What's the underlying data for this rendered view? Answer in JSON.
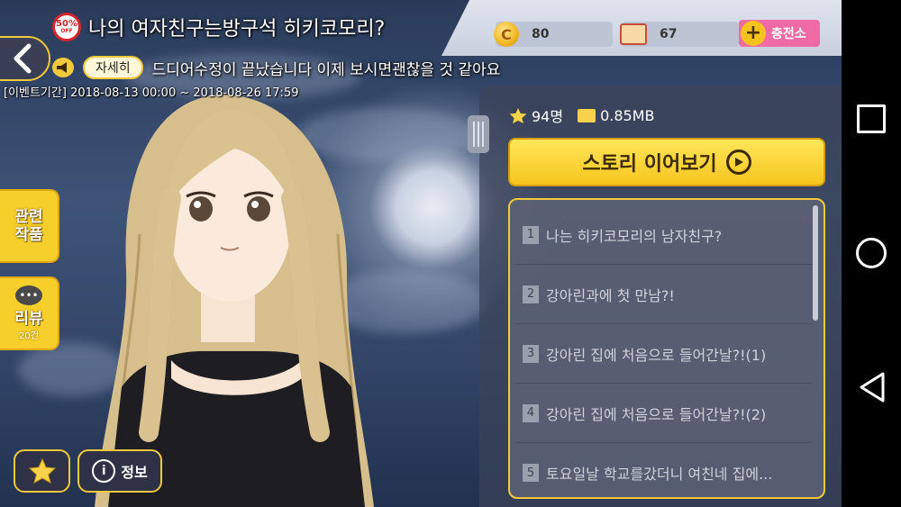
{
  "header": {
    "sale_badge": {
      "percent": "50%",
      "off": "OFF"
    },
    "title": "나의 여자친구는방구석 히키코모리?",
    "detail_button": "자세히",
    "notice": "드디어수정이 끝났습니다 이제 보시면괜찮을 것 같아요",
    "event_period": "[이벤트기간] 2018-08-13 00:00 ~ 2018-08-26 17:59"
  },
  "currency": {
    "coin_icon": "C",
    "coins": "80",
    "mail": "67",
    "charge_label": "충전소"
  },
  "side": {
    "related_label": "관련\n작품",
    "review_label": "리뷰",
    "review_count": "20건",
    "info_label": "정보"
  },
  "panel": {
    "likes": "94명",
    "size": "0.85MB",
    "continue_label": "스토리 이어보기",
    "episodes": [
      {
        "num": "1",
        "title": "나는 히키코모리의 남자친구?"
      },
      {
        "num": "2",
        "title": "강아린과에 첫 만남?!"
      },
      {
        "num": "3",
        "title": "강아린 집에 처음으로 들어간날?!(1)"
      },
      {
        "num": "4",
        "title": "강아린 집에 처음으로 들어간날?!(2)"
      },
      {
        "num": "5",
        "title": "토요일날 학교를갔더니 여친네 집에..."
      }
    ]
  },
  "icons": {
    "back": "chevron-left-icon",
    "megaphone": "megaphone-icon",
    "favorite": "star-icon",
    "info": "info-icon",
    "play": "play-circle-icon"
  },
  "colors": {
    "accent_yellow": "#f7cf2b",
    "charge_pink": "#f06aa6",
    "sale_red": "#d2262c"
  }
}
